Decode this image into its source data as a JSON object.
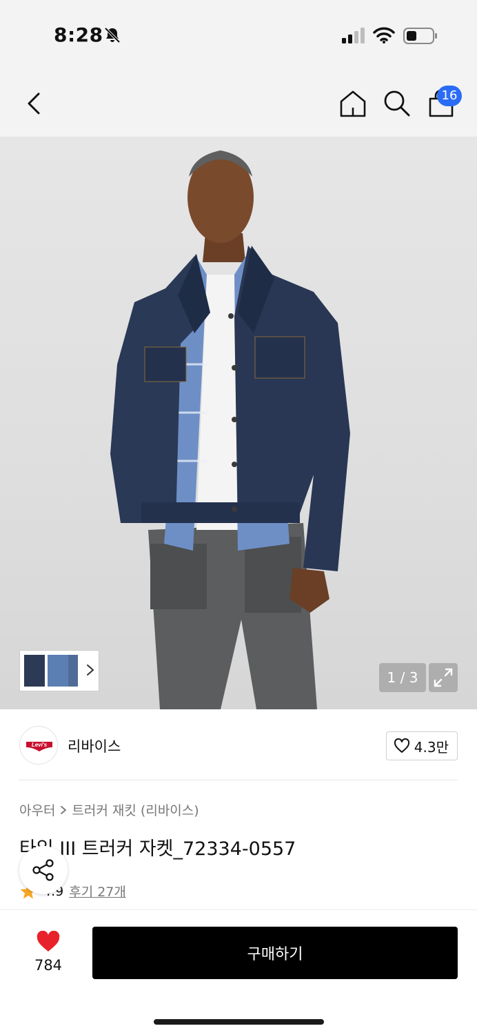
{
  "status_bar": {
    "time": "8:28"
  },
  "nav": {
    "cart_count": "16"
  },
  "gallery": {
    "counter": "1 / 3"
  },
  "brand": {
    "name": "리바이스",
    "logo_text": "Levi's",
    "likes": "4.3만"
  },
  "breadcrumb": {
    "category": "아우터",
    "subcategory": "트러커 재킷 (리바이스)"
  },
  "product": {
    "title": "타입 III 트러커 자켓_72334-0557",
    "rating": "4.9",
    "reviews": "후기 27개"
  },
  "bottom_bar": {
    "wish_count": "784",
    "buy_label": "구매하기"
  },
  "colors": {
    "badge": "#2b6cf6",
    "wish_heart": "#e8222a",
    "star": "#f5a623",
    "buy_button": "#000000"
  },
  "icons": [
    "bell-off-icon",
    "signal-icon",
    "wifi-icon",
    "battery-icon",
    "back-icon",
    "home-icon",
    "search-icon",
    "cart-icon",
    "chevron-right-icon",
    "expand-icon",
    "heart-outline-icon",
    "star-icon",
    "share-icon",
    "heart-filled-icon"
  ]
}
